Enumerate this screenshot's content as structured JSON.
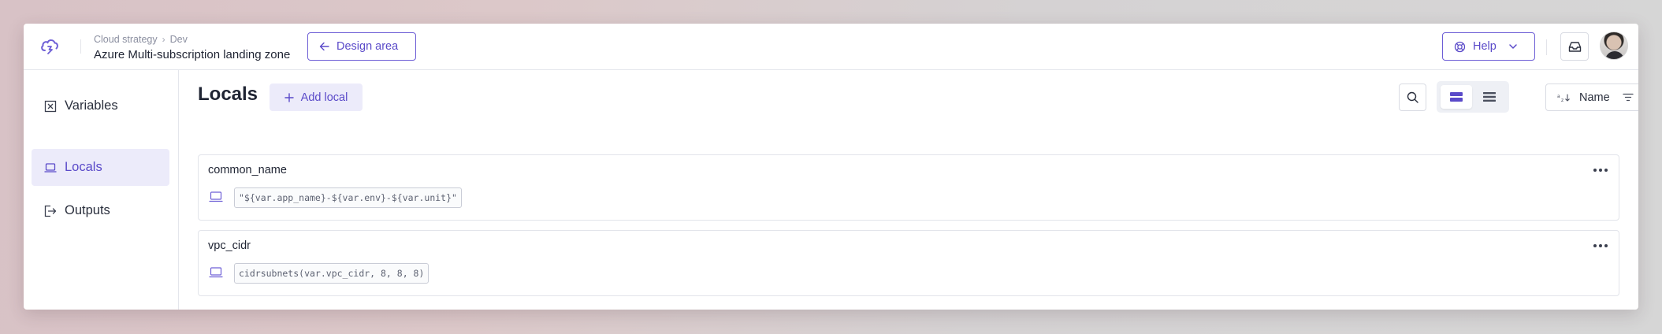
{
  "header": {
    "breadcrumb": [
      "Cloud strategy",
      "Dev"
    ],
    "breadcrumb_separator": "›",
    "project_title": "Azure Multi-subscription landing zone",
    "design_area_label": "Design area",
    "help_label": "Help"
  },
  "sidebar": {
    "items": [
      {
        "label": "Variables",
        "icon": "variables-icon",
        "active": false
      },
      {
        "label": "Locals",
        "icon": "laptop-icon",
        "active": true
      },
      {
        "label": "Outputs",
        "icon": "output-icon",
        "active": false
      }
    ]
  },
  "main": {
    "title": "Locals",
    "add_label": "Add local",
    "sort_label": "Name",
    "view_mode": "cards",
    "locals": [
      {
        "name": "common_name",
        "value": "\"${var.app_name}-${var.env}-${var.unit}\""
      },
      {
        "name": "vpc_cidr",
        "value": "cidrsubnets(var.vpc_cidr, 8, 8, 8)"
      }
    ]
  },
  "colors": {
    "accent": "#5a4ac9",
    "accent_bg": "#ecebfa",
    "border": "#e2e4ea"
  }
}
